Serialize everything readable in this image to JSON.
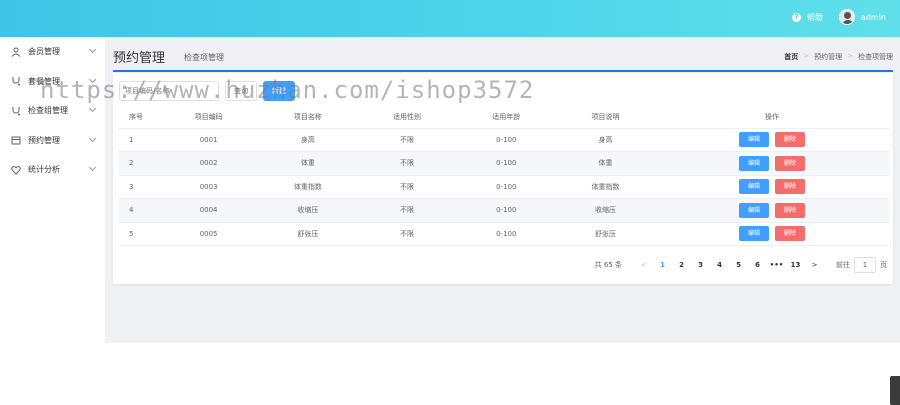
{
  "topbar": {
    "help_label": "帮助",
    "user_name": "admin"
  },
  "sidebar": {
    "items": [
      {
        "label": "会员管理",
        "icon": "user-icon"
      },
      {
        "label": "套餐管理",
        "icon": "stethoscope-icon"
      },
      {
        "label": "检查组管理",
        "icon": "stethoscope-icon"
      },
      {
        "label": "预约管理",
        "icon": "calendar-icon"
      },
      {
        "label": "统计分析",
        "icon": "heartbeat-icon"
      }
    ]
  },
  "header": {
    "title": "预约管理",
    "subtitle": "检查项管理",
    "breadcrumb": [
      "首页",
      "预约管理",
      "检查项管理"
    ]
  },
  "toolbar": {
    "search_placeholder": "项目编码/名称",
    "query_label": "查询",
    "new_label": "新建"
  },
  "table": {
    "columns": [
      "序号",
      "项目编码",
      "项目名称",
      "适用性别",
      "适用年龄",
      "项目说明",
      "操作"
    ],
    "rows": [
      {
        "idx": "1",
        "code": "0001",
        "name": "身高",
        "sex": "不限",
        "age": "0-100",
        "desc": "身高"
      },
      {
        "idx": "2",
        "code": "0002",
        "name": "体重",
        "sex": "不限",
        "age": "0-100",
        "desc": "体重"
      },
      {
        "idx": "3",
        "code": "0003",
        "name": "体重指数",
        "sex": "不限",
        "age": "0-100",
        "desc": "体重指数"
      },
      {
        "idx": "4",
        "code": "0004",
        "name": "收缩压",
        "sex": "不限",
        "age": "0-100",
        "desc": "收缩压"
      },
      {
        "idx": "5",
        "code": "0005",
        "name": "舒张压",
        "sex": "不限",
        "age": "0-100",
        "desc": "舒张压"
      }
    ],
    "edit_label": "编辑",
    "delete_label": "删除"
  },
  "pagination": {
    "total_text": "共 65 条",
    "pages": [
      "1",
      "2",
      "3",
      "4",
      "5",
      "6",
      "•••",
      "13"
    ],
    "current": "1",
    "goto_label": "前往",
    "goto_value": "1",
    "goto_suffix": "页"
  },
  "watermark": "https://www.huzhan.com/ishop3572",
  "colors": {
    "primary": "#409eff",
    "danger": "#f56c6c",
    "topbar": "#3ec5e6"
  }
}
